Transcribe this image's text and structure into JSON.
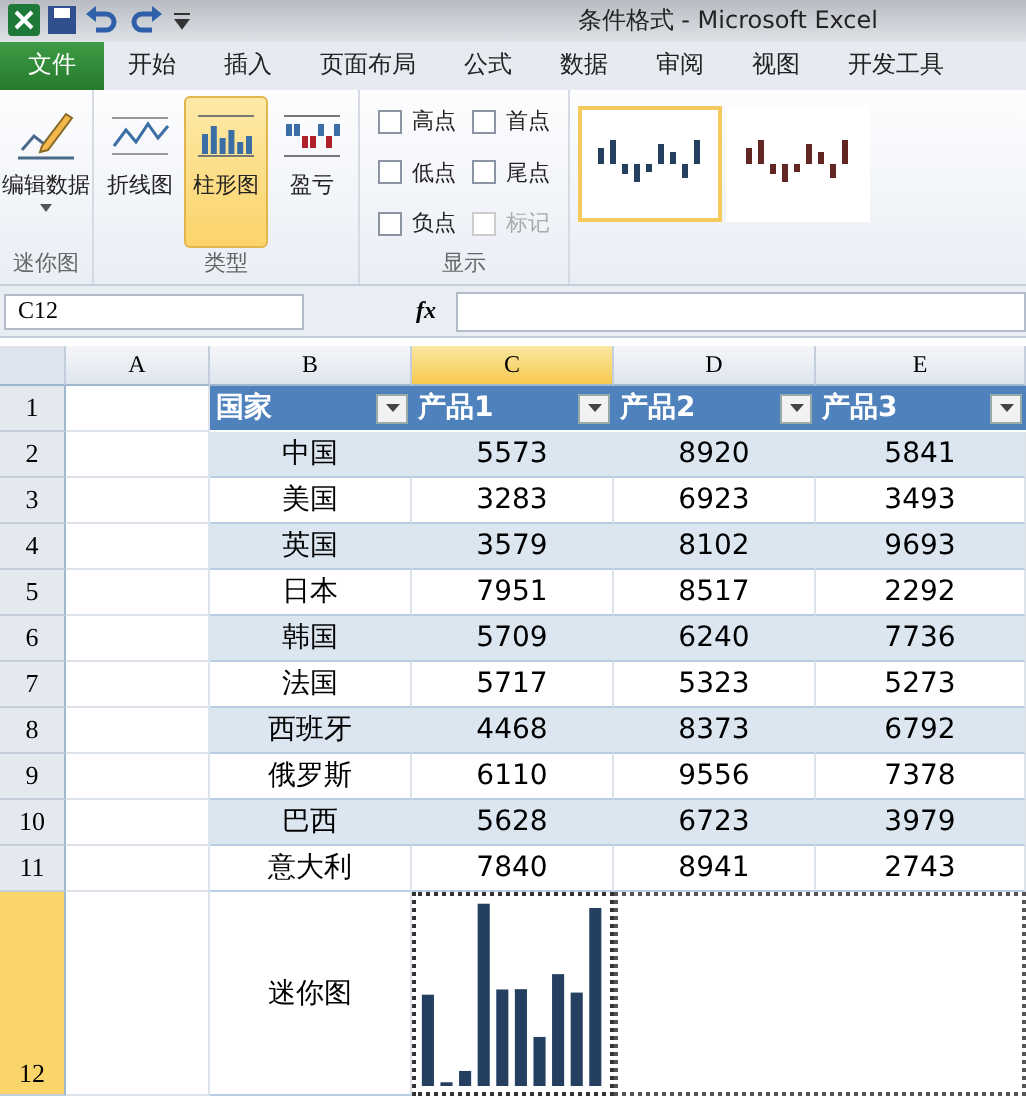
{
  "window": {
    "title": "条件格式 - Microsoft Excel"
  },
  "tabs": [
    {
      "label": "文件",
      "kind": "file",
      "selected": false
    },
    {
      "label": "开始",
      "kind": "tab",
      "selected": false
    },
    {
      "label": "插入",
      "kind": "tab",
      "selected": false
    },
    {
      "label": "页面布局",
      "kind": "tab",
      "selected": false
    },
    {
      "label": "公式",
      "kind": "tab",
      "selected": false
    },
    {
      "label": "数据",
      "kind": "tab",
      "selected": false
    },
    {
      "label": "审阅",
      "kind": "tab",
      "selected": false
    },
    {
      "label": "视图",
      "kind": "tab",
      "selected": false
    },
    {
      "label": "开发工具",
      "kind": "tab",
      "selected": false
    }
  ],
  "ribbon": {
    "groups": [
      {
        "label": "迷你图",
        "kind": "buttons",
        "buttons": [
          {
            "label": "编辑数据",
            "kind": "edit",
            "selected": false
          }
        ]
      },
      {
        "label": "类型",
        "kind": "buttons",
        "buttons": [
          {
            "label": "折线图",
            "kind": "line",
            "selected": false
          },
          {
            "label": "柱形图",
            "kind": "column",
            "selected": true
          },
          {
            "label": "盈亏",
            "kind": "winloss",
            "selected": false
          }
        ]
      },
      {
        "label": "显示",
        "kind": "checks",
        "checks": [
          {
            "label": "高点",
            "checked": false,
            "disabled": false
          },
          {
            "label": "首点",
            "checked": false,
            "disabled": false
          },
          {
            "label": "低点",
            "checked": false,
            "disabled": false
          },
          {
            "label": "尾点",
            "checked": false,
            "disabled": false
          },
          {
            "label": "负点",
            "checked": false,
            "disabled": false
          },
          {
            "label": "标记",
            "checked": false,
            "disabled": true
          }
        ]
      },
      {
        "kind": "gallery",
        "styles": [
          {
            "selected": true,
            "color": "#243f60"
          },
          {
            "selected": false,
            "color": "#632523"
          }
        ]
      }
    ]
  },
  "formula_bar": {
    "name_box": "C12",
    "fx": "fx"
  },
  "sheet": {
    "columns": [
      {
        "label": "A",
        "selected": false
      },
      {
        "label": "B",
        "selected": false
      },
      {
        "label": "C",
        "selected": true
      },
      {
        "label": "D",
        "selected": false
      },
      {
        "label": "E",
        "selected": false
      }
    ],
    "header_row": {
      "number": "1",
      "cells": [
        "",
        "国家",
        "产品1",
        "产品2",
        "产品3"
      ]
    },
    "rows": [
      {
        "number": "2",
        "cells": [
          "",
          "中国",
          "5573",
          "8920",
          "5841"
        ]
      },
      {
        "number": "3",
        "cells": [
          "",
          "美国",
          "3283",
          "6923",
          "3493"
        ]
      },
      {
        "number": "4",
        "cells": [
          "",
          "英国",
          "3579",
          "8102",
          "9693"
        ]
      },
      {
        "number": "5",
        "cells": [
          "",
          "日本",
          "7951",
          "8517",
          "2292"
        ]
      },
      {
        "number": "6",
        "cells": [
          "",
          "韩国",
          "5709",
          "6240",
          "7736"
        ]
      },
      {
        "number": "7",
        "cells": [
          "",
          "法国",
          "5717",
          "5323",
          "5273"
        ]
      },
      {
        "number": "8",
        "cells": [
          "",
          "西班牙",
          "4468",
          "8373",
          "6792"
        ]
      },
      {
        "number": "9",
        "cells": [
          "",
          "俄罗斯",
          "6110",
          "9556",
          "7378"
        ]
      },
      {
        "number": "10",
        "cells": [
          "",
          "巴西",
          "5628",
          "6723",
          "3979"
        ]
      },
      {
        "number": "11",
        "cells": [
          "",
          "意大利",
          "7840",
          "8941",
          "2743"
        ]
      }
    ],
    "sparkline_row": {
      "number": "12",
      "label": "迷你图",
      "selected": true
    }
  }
}
